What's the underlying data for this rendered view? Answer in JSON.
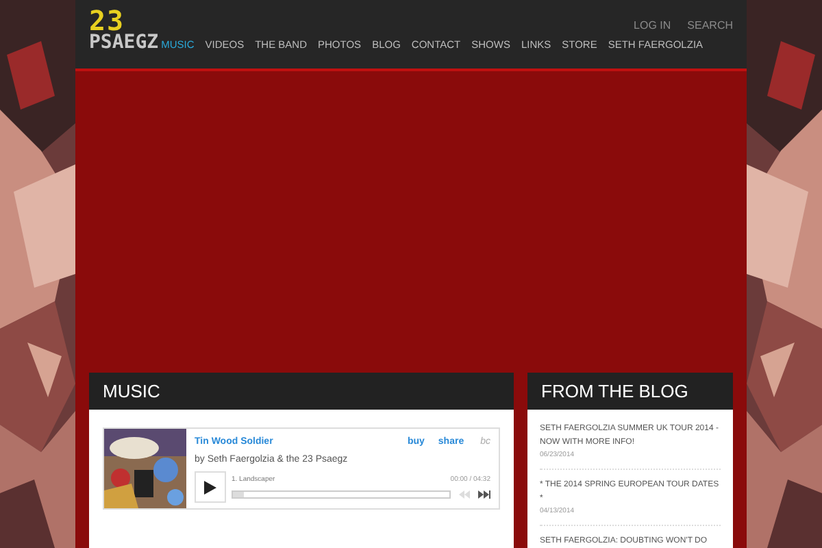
{
  "logo": {
    "number": "23",
    "name": "PSAEGZ"
  },
  "top_links": [
    "LOG IN",
    "SEARCH"
  ],
  "nav": [
    {
      "label": "MUSIC",
      "selected": true
    },
    {
      "label": "VIDEOS",
      "selected": false
    },
    {
      "label": "THE BAND",
      "selected": false
    },
    {
      "label": "PHOTOS",
      "selected": false
    },
    {
      "label": "BLOG",
      "selected": false
    },
    {
      "label": "CONTACT",
      "selected": false
    },
    {
      "label": "SHOWS",
      "selected": false
    },
    {
      "label": "LINKS",
      "selected": false
    },
    {
      "label": "STORE",
      "selected": false
    },
    {
      "label": "SETH FAERGOLZIA",
      "selected": false
    }
  ],
  "music": {
    "title": "MUSIC",
    "player": {
      "track_title": "Tin Wood Soldier",
      "artist": "by Seth Faergolzia & the 23 Psaegz",
      "buy": "buy",
      "share": "share",
      "brand": "bc",
      "track": "1. Landscaper",
      "time": "00:00 / 04:32",
      "level": 0.05
    }
  },
  "blog": {
    "title": "FROM THE BLOG",
    "posts": [
      {
        "title": "SETH FAERGOLZIA SUMMER UK TOUR 2014 - NOW WITH MORE INFO!",
        "date": "06/23/2014"
      },
      {
        "title": "* THE 2014 SPRING EUROPEAN TOUR DATES *",
        "date": "04/13/2014"
      },
      {
        "title": "SETH FAERGOLZIA: DOUBTING WON'T DO"
      }
    ]
  }
}
